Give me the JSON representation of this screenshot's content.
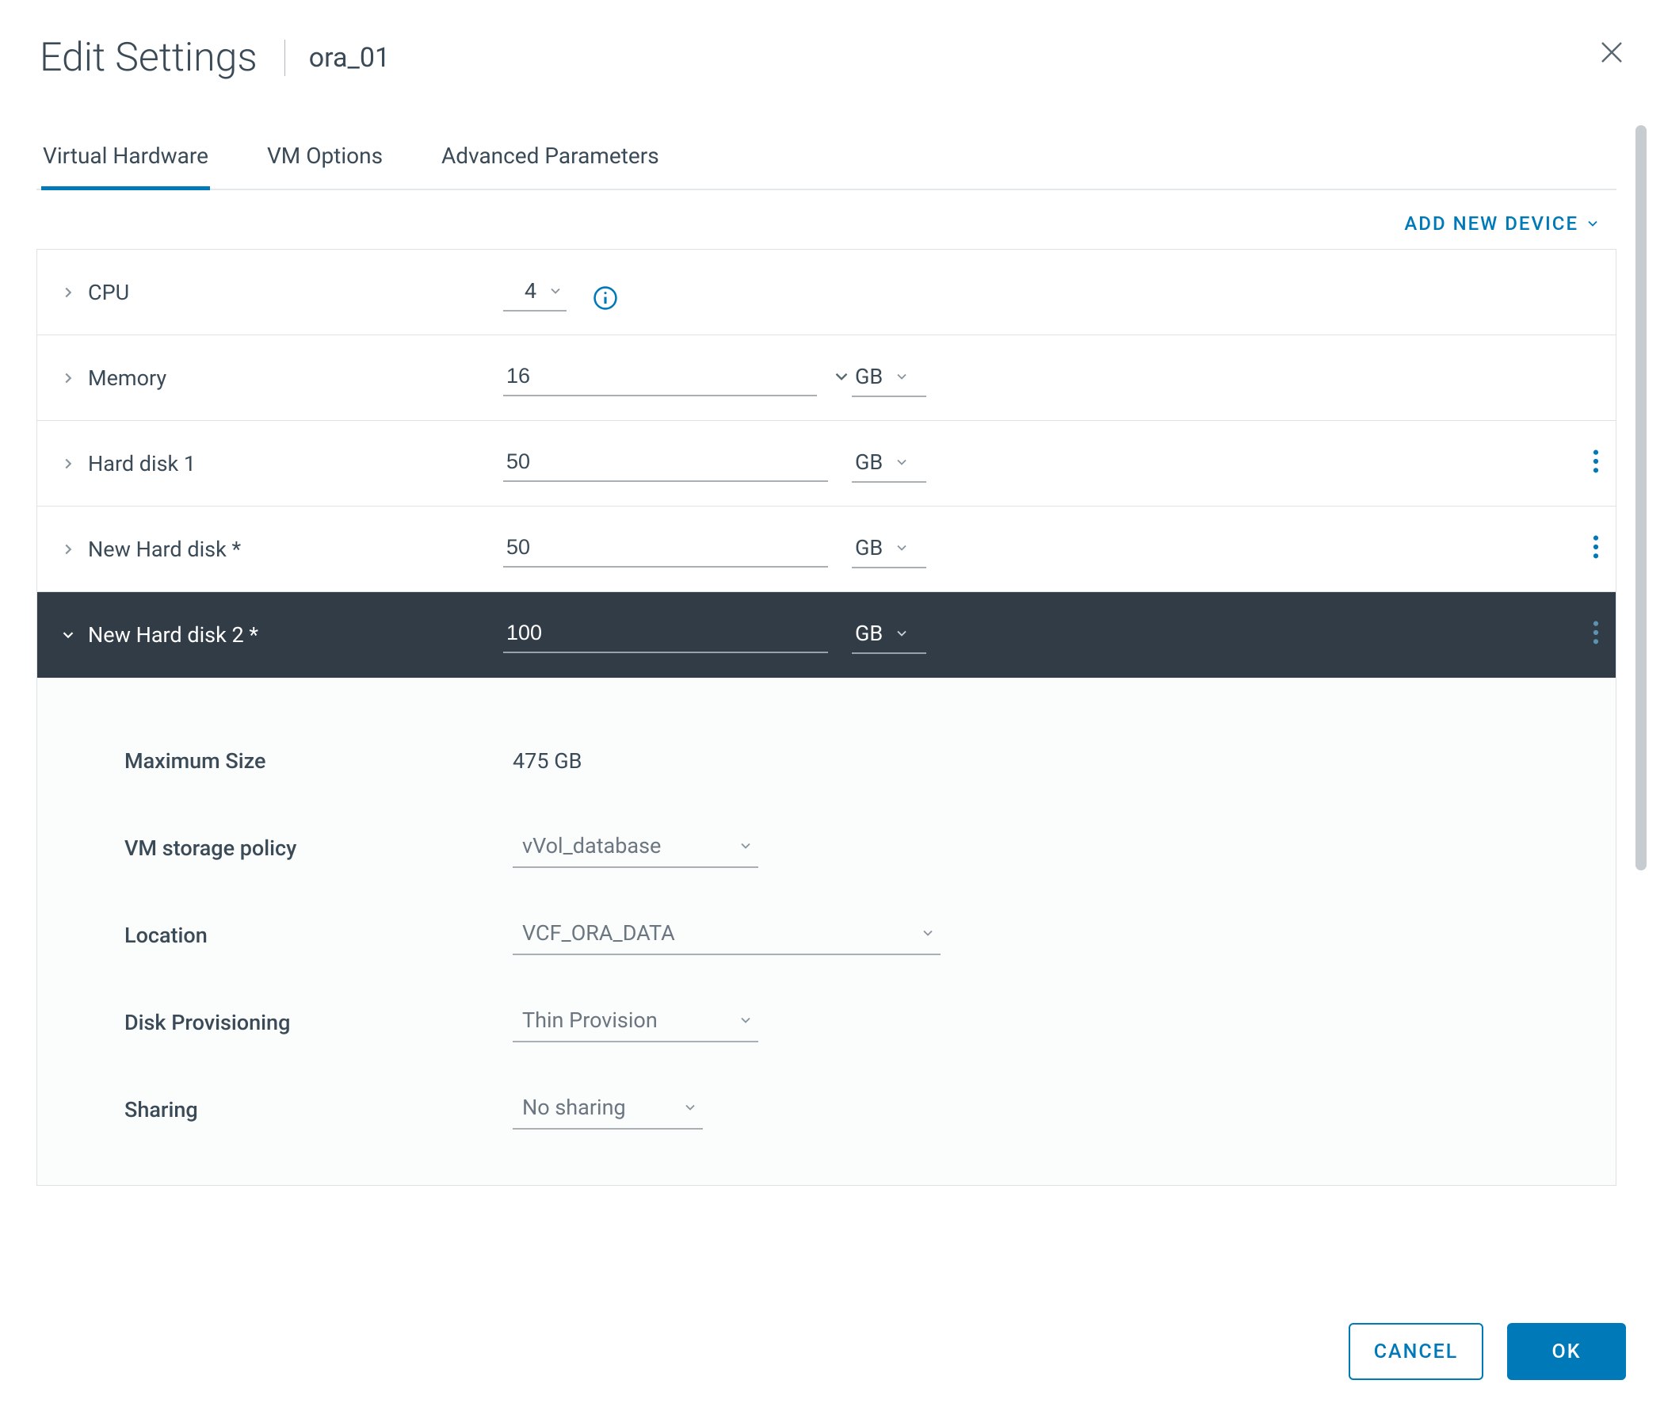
{
  "header": {
    "title": "Edit Settings",
    "vm_name": "ora_01"
  },
  "tabs": [
    {
      "label": "Virtual Hardware",
      "active": true
    },
    {
      "label": "VM Options",
      "active": false
    },
    {
      "label": "Advanced Parameters",
      "active": false
    }
  ],
  "add_device_label": "ADD NEW DEVICE",
  "hardware": {
    "cpu": {
      "label": "CPU",
      "value": "4"
    },
    "memory": {
      "label": "Memory",
      "value": "16",
      "unit": "GB"
    },
    "hd1": {
      "label": "Hard disk 1",
      "value": "50",
      "unit": "GB"
    },
    "nhd": {
      "label": "New Hard disk *",
      "value": "50",
      "unit": "GB"
    },
    "nhd2": {
      "label": "New Hard disk 2 *",
      "value": "100",
      "unit": "GB"
    }
  },
  "detail": {
    "max_size": {
      "label": "Maximum Size",
      "value": "475 GB"
    },
    "storage_policy": {
      "label": "VM storage policy",
      "value": "vVol_database"
    },
    "location": {
      "label": "Location",
      "value": "VCF_ORA_DATA"
    },
    "provisioning": {
      "label": "Disk Provisioning",
      "value": "Thin Provision"
    },
    "sharing": {
      "label": "Sharing",
      "value": "No sharing"
    }
  },
  "footer": {
    "cancel": "CANCEL",
    "ok": "OK"
  }
}
